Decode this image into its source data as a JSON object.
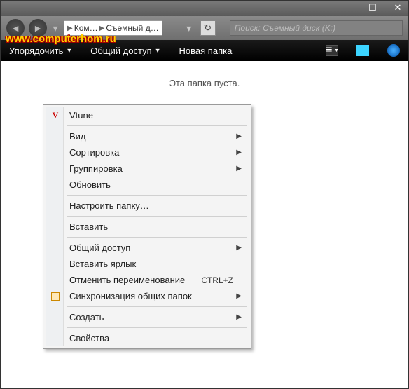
{
  "titlebar": {
    "min": "—",
    "max": "☐",
    "close": "✕"
  },
  "nav": {
    "crumb1": "Ком…",
    "crumb2": "Съемный д…",
    "search_placeholder": "Поиск: Съемный диск (K:)"
  },
  "watermark": "www.computerhom.ru",
  "toolbar": {
    "organize": "Упорядочить",
    "share": "Общий доступ",
    "newfolder": "Новая папка"
  },
  "content": {
    "empty": "Эта папка пуста."
  },
  "menu": {
    "vtune": "Vtune",
    "view": "Вид",
    "sort": "Сортировка",
    "group": "Группировка",
    "refresh": "Обновить",
    "customize": "Настроить папку…",
    "paste": "Вставить",
    "share": "Общий доступ",
    "paste_shortcut": "Вставить ярлык",
    "undo_rename": "Отменить переименование",
    "undo_key": "CTRL+Z",
    "sync": "Синхронизация общих папок",
    "new": "Создать",
    "props": "Свойства"
  }
}
